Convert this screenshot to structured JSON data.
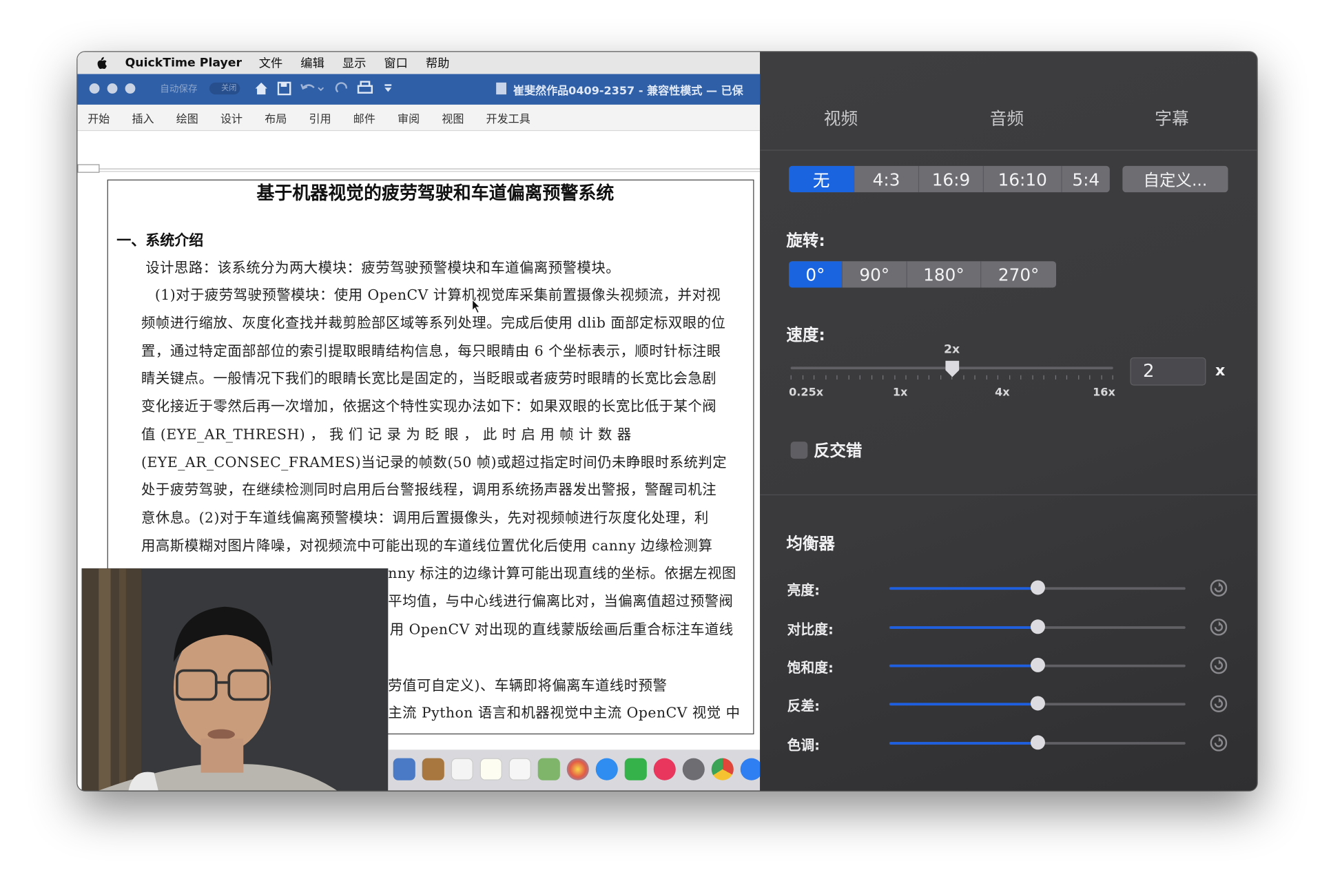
{
  "menubar": {
    "app": "QuickTime Player",
    "items": [
      "文件",
      "编辑",
      "显示",
      "窗口",
      "帮助"
    ]
  },
  "word": {
    "autosave": "自动保存",
    "toggle": "关闭",
    "title": "崔斐然作品0409-2357 - 兼容性模式 — 已保",
    "ribbon": [
      "开始",
      "插入",
      "绘图",
      "设计",
      "布局",
      "引用",
      "邮件",
      "审阅",
      "视图",
      "开发工具"
    ]
  },
  "document": {
    "title": "基于机器视觉的疲劳驾驶和车道偏离预警系统",
    "heading": "一、系统介绍",
    "lines": [
      "设计思路：该系统分为两大模块：疲劳驾驶预警模块和车道偏离预警模块。",
      "(1)对于疲劳驾驶预警模块：使用 OpenCV 计算机视觉库采集前置摄像头视频流，并对视",
      "频帧进行缩放、灰度化查找并裁剪脸部区域等系列处理。完成后使用 dlib 面部定标双眼的位",
      "置，通过特定面部部位的索引提取眼睛结构信息，每只眼睛由 6 个坐标表示，顺时针标注眼",
      "睛关键点。一般情况下我们的眼睛长宽比是固定的，当眨眼或者疲劳时眼睛的长宽比会急剧",
      "变化接近于零然后再一次增加，依据这个特性实现办法如下：如果双眼的长宽比低于某个阀",
      "值 (EYE_AR_THRESH) ， 我 们 记 录 为 眨 眼 ， 此 时 启 用 帧 计 数 器",
      "(EYE_AR_CONSEC_FRAMES)当记录的帧数(50 帧)或超过指定时间仍未睁眼时系统判定",
      "处于疲劳驾驶，在继续检测同时启用后台警报线程，调用系统扬声器发出警报，警醒司机注",
      "意休息。(2)对于车道线偏离预警模块：调用后置摄像头，先对视频帧进行灰度化处理，利",
      "用高斯模糊对图片降噪，对视频流中可能出现的车道线位置优化后使用 canny 边缘检测算",
      "nny 标注的边缘计算可能出现直线的坐标。依据左视图",
      "平均值，与中心线进行偏离比对，当偏离值超过预警阀",
      "用 OpenCV 对出现的直线蒙版绘画后重合标注车道线",
      "劳值可自定义)、车辆即将偏离车道线时预警",
      "主流 Python 语言和机器视觉中主流 OpenCV 视觉 中"
    ]
  },
  "panel": {
    "tabs": [
      "视频",
      "音频",
      "字幕"
    ],
    "aspect": {
      "options": [
        "无",
        "4:3",
        "16:9",
        "16:10",
        "5:4"
      ],
      "selected": "无",
      "custom": "自定义..."
    },
    "rotation": {
      "label": "旋转:",
      "options": [
        "0°",
        "90°",
        "180°",
        "270°"
      ],
      "selected": "0°"
    },
    "speed": {
      "label": "速度:",
      "value": "2",
      "unit": "x",
      "current_label": "2x",
      "ticks": [
        "0.25x",
        "1x",
        "4x",
        "16x"
      ],
      "position": 0.5
    },
    "deinterlace": {
      "label": "反交错",
      "checked": false
    },
    "equalizer": {
      "title": "均衡器",
      "items": [
        {
          "label": "亮度:",
          "value": 0.5
        },
        {
          "label": "对比度:",
          "value": 0.5
        },
        {
          "label": "饱和度:",
          "value": 0.5
        },
        {
          "label": "反差:",
          "value": 0.5
        },
        {
          "label": "色调:",
          "value": 0.5
        }
      ]
    }
  },
  "colors": {
    "accent": "#1a64e0",
    "panel": "#3b3b3d",
    "word_title": "#2f5fa7"
  }
}
